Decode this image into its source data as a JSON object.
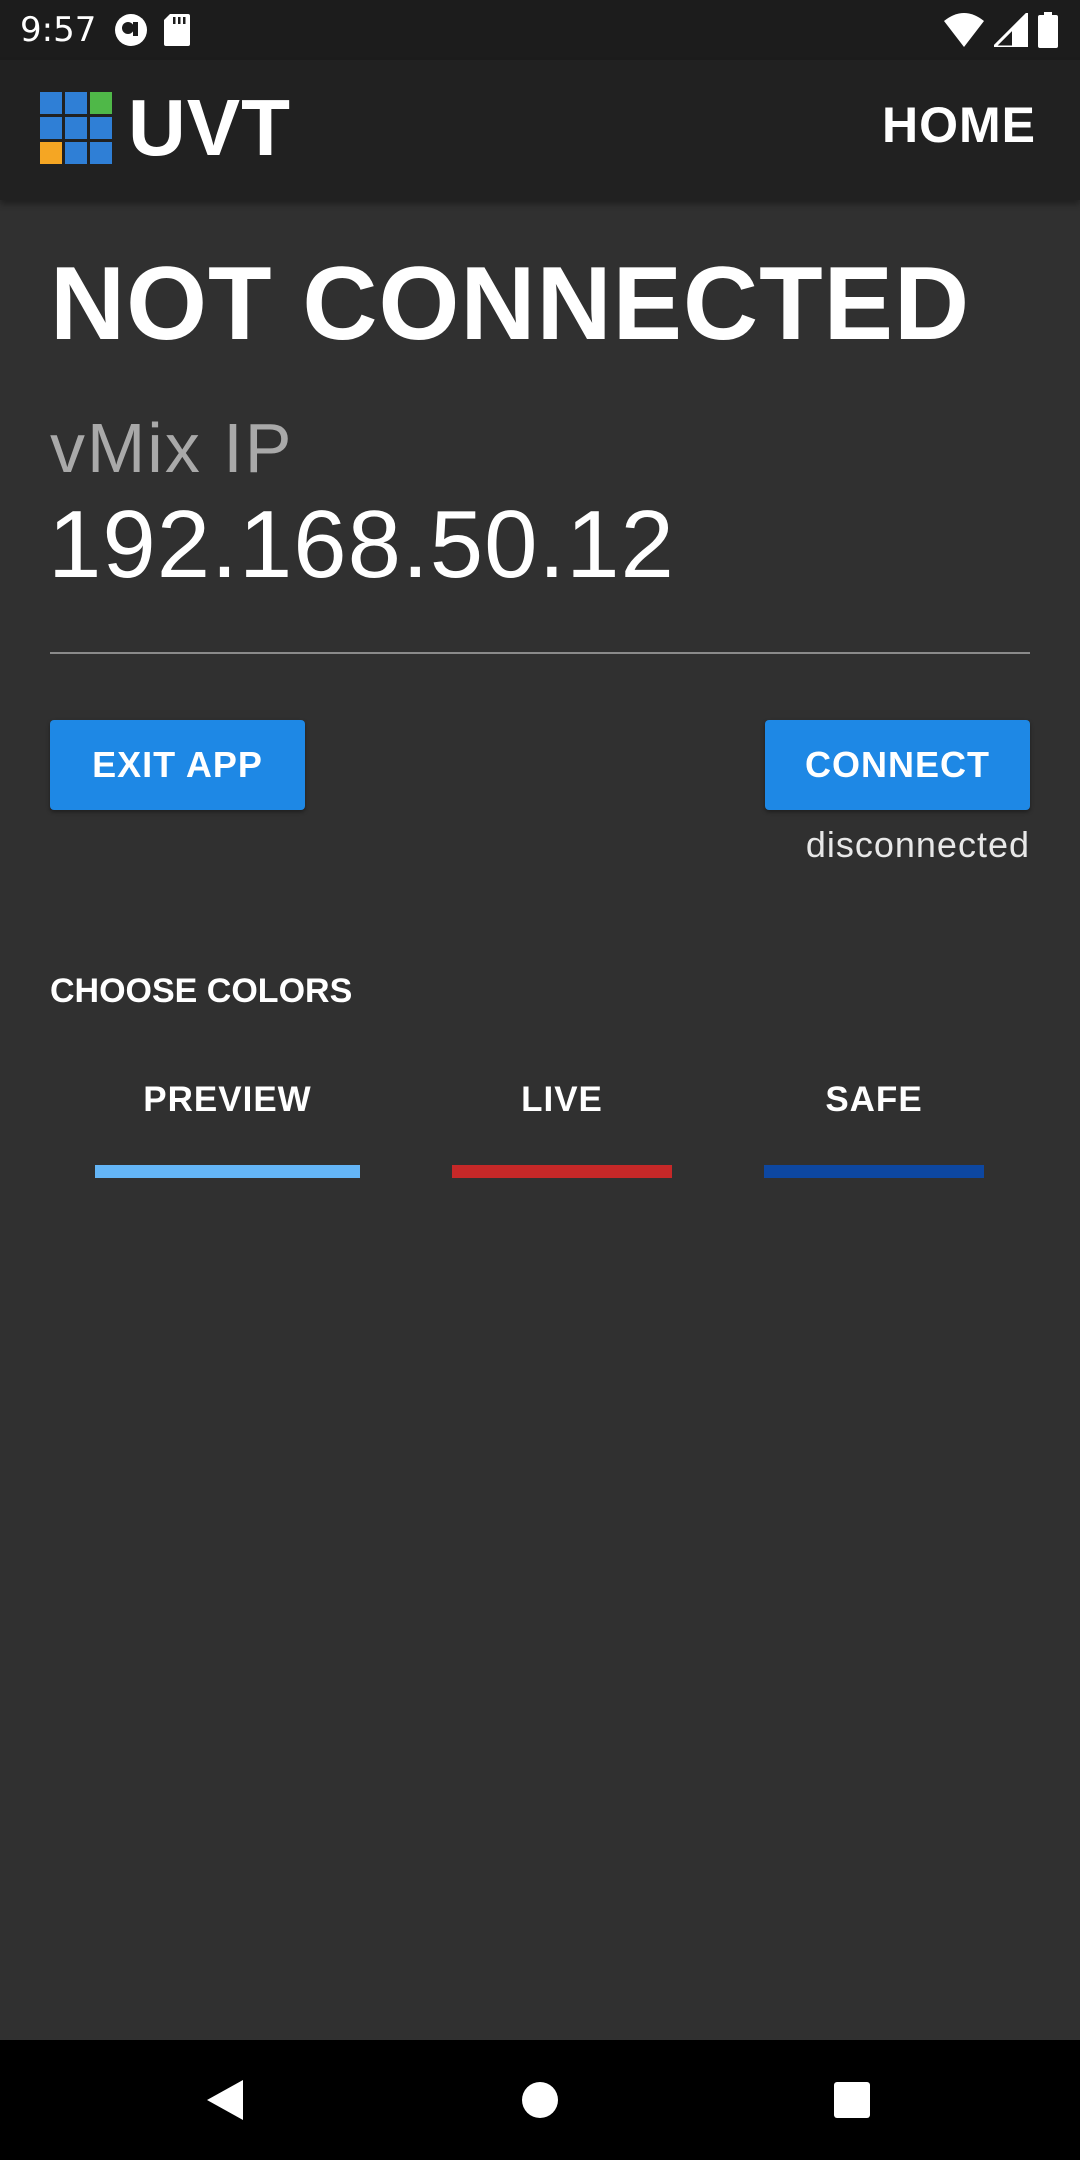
{
  "status_bar": {
    "time": "9:57",
    "icons": [
      "record-icon",
      "sd-card-icon",
      "wifi-icon",
      "signal-icon",
      "battery-icon"
    ]
  },
  "app_bar": {
    "brand": "UVT",
    "logo_colors": [
      "#2f7fd6",
      "#2f7fd6",
      "#4fb848",
      "#2f7fd6",
      "#2f7fd6",
      "#2f7fd6",
      "#f5a623",
      "#2f7fd6",
      "#2f7fd6"
    ],
    "home_label": "HOME"
  },
  "connection": {
    "heading": "NOT CONNECTED",
    "ip_label": "vMix IP",
    "ip_value": "192.168.50.12",
    "status_text": "disconnected"
  },
  "buttons": {
    "exit_label": "EXIT APP",
    "connect_label": "CONNECT",
    "accent": "#1e88e5"
  },
  "colors_section": {
    "title": "CHOOSE COLORS",
    "tabs": [
      {
        "label": "PREVIEW",
        "color": "#64b5f6"
      },
      {
        "label": "LIVE",
        "color": "#c62828"
      },
      {
        "label": "SAFE",
        "color": "#0d47a1"
      }
    ]
  },
  "nav_bar": {
    "buttons": [
      "back-icon",
      "home-icon",
      "recents-icon"
    ]
  }
}
